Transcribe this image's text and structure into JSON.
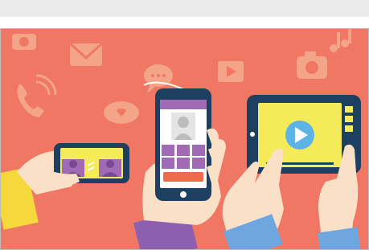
{
  "header": {
    "bar_color": "#ebebeb"
  },
  "illustration": {
    "background_color": "#f07763",
    "device_bezel_color": "#1d4060",
    "screen_yellow": "#f4ea5a",
    "screen_purple": "#a06ab4",
    "accent_orange": "#ee6c4d",
    "skin_color": "#fbe0c8",
    "sleeve_blue": "#6ea7df",
    "sleeve_yellow": "#f5d83c",
    "sleeve_purple": "#8d5fb0",
    "icons": [
      "camera-icon",
      "mail-icon",
      "phone-call-icon",
      "chat-icon",
      "play-icon",
      "camera-icon",
      "heart-cloud-icon",
      "music-note-icon"
    ],
    "devices": [
      "landscape-phone-video-call",
      "portrait-phone-contact",
      "tablet-video-player"
    ]
  }
}
